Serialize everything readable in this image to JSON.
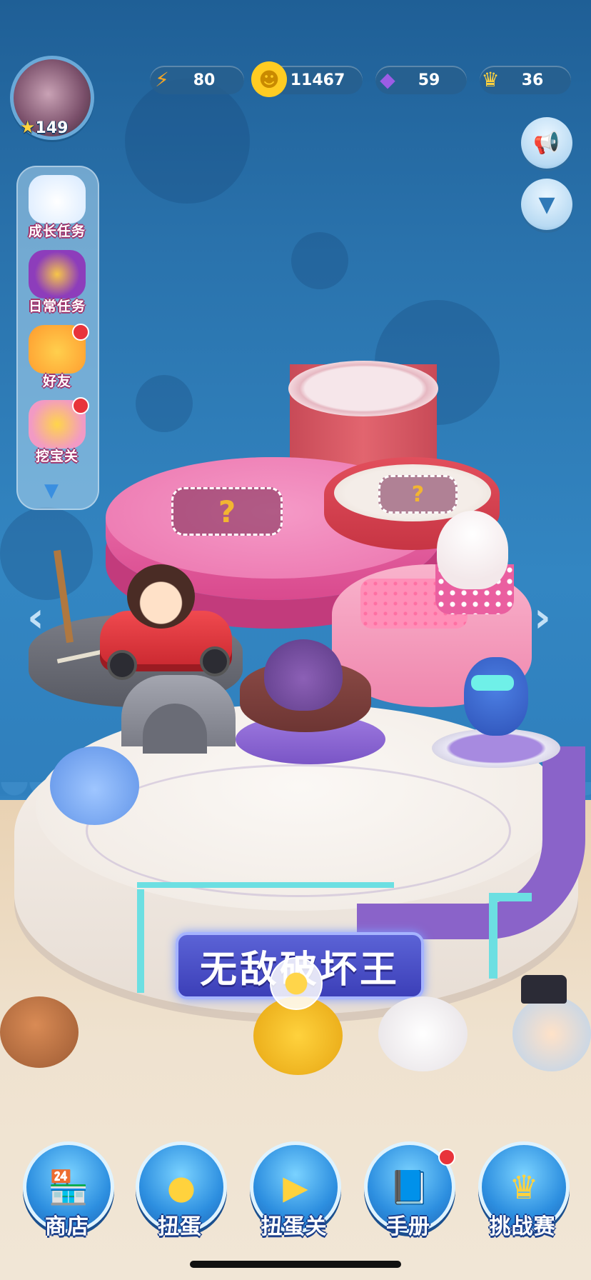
{
  "player": {
    "level": "149",
    "star_icon": "star-icon"
  },
  "resources": [
    {
      "icon": "lightning-icon",
      "value": "80",
      "color": "#f5a623"
    },
    {
      "icon": "coin-icon",
      "value": "11467",
      "color": "#ffcc22"
    },
    {
      "icon": "gem-icon",
      "value": "59",
      "color": "#9b5de5"
    },
    {
      "icon": "crown-icon",
      "value": "36",
      "color": "#c77dff"
    }
  ],
  "side_menu": [
    {
      "label": "成长任务",
      "icon": "cloud-mascot-icon",
      "badge": false
    },
    {
      "label": "日常任务",
      "icon": "treasure-chest-icon",
      "badge": false
    },
    {
      "label": "好友",
      "icon": "chicks-icon",
      "badge": true
    },
    {
      "label": "挖宝关",
      "icon": "gold-chest-icon",
      "badge": true
    }
  ],
  "stage": {
    "banner": "无敌破坏王",
    "locked_slot_symbol": "?"
  },
  "nav": [
    {
      "label": "商店",
      "icon": "shop-icon"
    },
    {
      "label": "扭蛋",
      "icon": "gacha-icon"
    },
    {
      "label": "扭蛋关",
      "icon": "play-icon"
    },
    {
      "label": "手册",
      "icon": "book-icon",
      "badge": true
    },
    {
      "label": "挑战赛",
      "icon": "trophy-crown-icon"
    }
  ],
  "colors": {
    "sky": "#2f7fbd",
    "floor": "#ead9c0",
    "banner": "#4a4fc8",
    "badge": "#e8333b"
  }
}
